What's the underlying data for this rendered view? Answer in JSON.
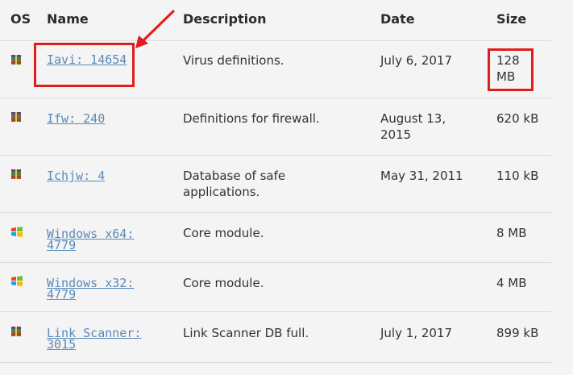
{
  "table": {
    "headers": {
      "os": "OS",
      "name": "Name",
      "description": "Description",
      "date": "Date",
      "size": "Size"
    },
    "rows": [
      {
        "os_icon": "archive-icon",
        "name": "Iavi: 14654",
        "description": "Virus definitions.",
        "date": "July 6, 2017",
        "size": "128 MB",
        "highlighted": true
      },
      {
        "os_icon": "archive-icon",
        "name": "Ifw: 240",
        "description": "Definitions for firewall.",
        "date": "August 13, 2015",
        "size": "620 kB"
      },
      {
        "os_icon": "archive-icon",
        "name": "Ichjw: 4",
        "description": "Database of safe applications.",
        "date": "May 31, 2011",
        "size": "110 kB"
      },
      {
        "os_icon": "windows-logo-icon",
        "name": "Windows x64: 4779",
        "description": "Core module.",
        "date": "",
        "size": "8 MB"
      },
      {
        "os_icon": "windows-logo-icon",
        "name": "Windows x32: 4779",
        "description": "Core module.",
        "date": "",
        "size": "4 MB"
      },
      {
        "os_icon": "archive-icon",
        "name": "Link Scanner: 3015",
        "description": "Link Scanner DB full.",
        "date": "July 1, 2017",
        "size": "899 kB"
      }
    ]
  },
  "annotations": {
    "color": "#e01c1c",
    "arrow": "pointing to first row name"
  }
}
